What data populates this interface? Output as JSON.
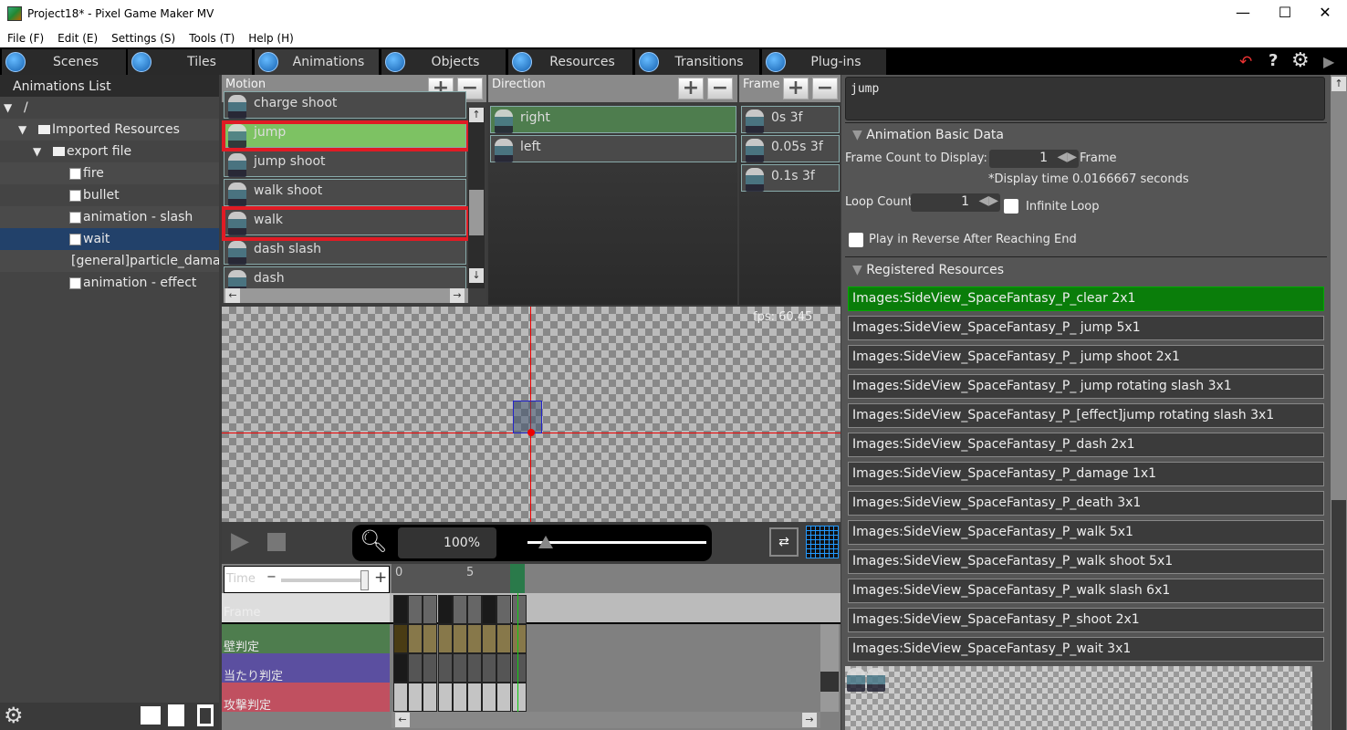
{
  "window": {
    "title": "Project18* - Pixel Game Maker MV",
    "minimize": "—",
    "maximize": "☐",
    "close": "✕"
  },
  "menu": [
    "File (F)",
    "Edit (E)",
    "Settings (S)",
    "Tools (T)",
    "Help (H)"
  ],
  "tabs": [
    {
      "label": "Scenes",
      "icon": "scenes-icon"
    },
    {
      "label": "Tiles",
      "icon": "tiles-icon"
    },
    {
      "label": "Animations",
      "icon": "animations-icon",
      "active": true
    },
    {
      "label": "Objects",
      "icon": "objects-icon"
    },
    {
      "label": "Resources",
      "icon": "resources-icon"
    },
    {
      "label": "Transitions",
      "icon": "transitions-icon"
    },
    {
      "label": "Plug-ins",
      "icon": "plugins-icon"
    }
  ],
  "toolbar_right": {
    "undo": "↶",
    "help": "?",
    "settings": "⚙",
    "play": "▶"
  },
  "animations_list": {
    "title": "Animations List",
    "tree": [
      {
        "label": "/",
        "level": 0,
        "type": "root"
      },
      {
        "label": "Imported Resources",
        "level": 1,
        "type": "folder"
      },
      {
        "label": "export file",
        "level": 2,
        "type": "folder"
      },
      {
        "label": "fire",
        "level": 3,
        "type": "animation"
      },
      {
        "label": "bullet",
        "level": 3,
        "type": "animation"
      },
      {
        "label": "animation - slash",
        "level": 3,
        "type": "animation"
      },
      {
        "label": "wait",
        "level": 3,
        "type": "animation",
        "selected": true
      },
      {
        "label": "[general]particle_damage",
        "level": 3,
        "type": "particle"
      },
      {
        "label": "animation - effect",
        "level": 3,
        "type": "animation"
      }
    ]
  },
  "motion": {
    "title": "Motion",
    "add": "+",
    "remove": "−",
    "items": [
      "charge shoot",
      "jump",
      "jump shoot",
      "walk shoot",
      "walk",
      "dash slash",
      "dash"
    ],
    "selected": "jump",
    "highlighted": [
      "jump",
      "walk"
    ]
  },
  "direction": {
    "title": "Direction",
    "add": "+",
    "remove": "−",
    "items": [
      "right",
      "left"
    ],
    "selected": "right"
  },
  "frame": {
    "title": "Frame",
    "add": "+",
    "remove": "−",
    "items": [
      "0s 3f",
      "0.05s 3f",
      "0.1s 3f"
    ]
  },
  "preview": {
    "fps": "fps: 60.45",
    "zoom": "100%",
    "zoom_slider": 0.1
  },
  "timeline": {
    "time_label": "Time",
    "ticks": [
      "0",
      "5"
    ],
    "time_zoom": 0.95,
    "tracks": [
      "Frame",
      "壁判定",
      "当たり判定",
      "攻撃判定"
    ],
    "track_colors": [
      "#d8d8d8",
      "#4e7d4e",
      "#5b4fa0",
      "#c05060"
    ]
  },
  "props": {
    "name": "jump",
    "basic_title": "Animation Basic Data",
    "frame_count_label": "Frame Count to Display:",
    "frame_count": "1",
    "frame_unit": "Frame",
    "display_time": "*Display time 0.0166667 seconds",
    "loop_label": "Loop Count",
    "loop_count": "1",
    "infinite_loop": "Infinite Loop",
    "infinite_loop_checked": false,
    "reverse": "Play in Reverse After Reaching End",
    "reverse_checked": false,
    "registered_title": "Registered Resources",
    "resources": [
      "Images:SideView_SpaceFantasy_P_clear 2x1",
      "Images:SideView_SpaceFantasy_P_ jump 5x1",
      "Images:SideView_SpaceFantasy_P_ jump shoot 2x1",
      "Images:SideView_SpaceFantasy_P_ jump rotating slash 3x1",
      "Images:SideView_SpaceFantasy_P_[effect]jump rotating slash 3x1",
      "Images:SideView_SpaceFantasy_P_dash 2x1",
      "Images:SideView_SpaceFantasy_P_damage 1x1",
      "Images:SideView_SpaceFantasy_P_death 3x1",
      "Images:SideView_SpaceFantasy_P_walk 5x1",
      "Images:SideView_SpaceFantasy_P_walk shoot 5x1",
      "Images:SideView_SpaceFantasy_P_walk slash 6x1",
      "Images:SideView_SpaceFantasy_P_shoot 2x1",
      "Images:SideView_SpaceFantasy_P_wait 3x1"
    ],
    "selected_resource": 0
  }
}
